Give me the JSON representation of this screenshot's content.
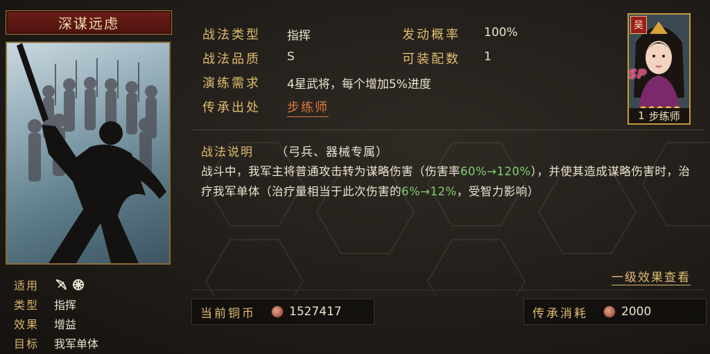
{
  "skill": {
    "name": "深谋远虑",
    "usable": {
      "label": "适用",
      "icons": [
        "bow-icon",
        "siege-wheel-icon"
      ]
    },
    "type": {
      "label": "类型",
      "value": "指挥"
    },
    "effect": {
      "label": "效果",
      "value": "增益"
    },
    "target": {
      "label": "目标",
      "value": "我军单体"
    }
  },
  "stats": {
    "type": {
      "label": "战法类型",
      "value": "指挥"
    },
    "quality": {
      "label": "战法品质",
      "value": "S"
    },
    "requirement": {
      "label": "演练需求",
      "value": "4星武将，每个增加5%进度"
    },
    "source": {
      "label": "传承出处",
      "value": "步练师"
    },
    "trigger_rate": {
      "label": "发动概率",
      "value": "100%"
    },
    "equip_count": {
      "label": "可装配数",
      "value": "1"
    }
  },
  "description": {
    "title": "战法说明",
    "tag": "（弓兵、器械专属）",
    "part1": "战斗中，我军主将普通攻击转为谋略伤害（伤害率",
    "hl1": "60%→120%",
    "part2": "），并使其造成谋略伤害时，治疗我军单体（治疗量相当于此次伤害的",
    "hl2": "6%→12%",
    "part3": "，受智力影响）",
    "highlight_color": "#7fd06a"
  },
  "effect_link": "一级效果查看",
  "currency": {
    "label": "当前铜币",
    "value": "1527417"
  },
  "cost": {
    "label": "传承消耗",
    "value": "2000"
  },
  "hero": {
    "faction": "吴",
    "rarity_tag": "SP",
    "stars": "●●●●●",
    "level": "1",
    "name": "步练师"
  }
}
